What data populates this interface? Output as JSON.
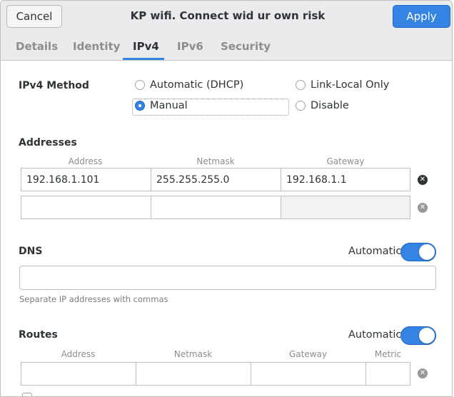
{
  "header": {
    "cancel_label": "Cancel",
    "title": "KP wifi. Connect wid ur own risk",
    "apply_label": "Apply",
    "accent_color": "#3584e4"
  },
  "tabs": [
    {
      "label": "Details"
    },
    {
      "label": "Identity"
    },
    {
      "label": "IPv4"
    },
    {
      "label": "IPv6"
    },
    {
      "label": "Security"
    }
  ],
  "active_tab": "IPv4",
  "method": {
    "label": "IPv4 Method",
    "options": [
      {
        "label": "Automatic (DHCP)",
        "selected": false
      },
      {
        "label": "Link-Local Only",
        "selected": false
      },
      {
        "label": "Manual",
        "selected": true
      },
      {
        "label": "Disable",
        "selected": false
      }
    ]
  },
  "addresses": {
    "label": "Addresses",
    "columns": [
      "Address",
      "Netmask",
      "Gateway"
    ],
    "rows": [
      [
        "192.168.1.101",
        "255.255.255.0",
        "192.168.1.1"
      ],
      [
        "",
        "",
        ""
      ]
    ]
  },
  "dns": {
    "label": "DNS",
    "automatic_label": "Automatic",
    "automatic": true,
    "value": "",
    "hint": "Separate IP addresses with commas"
  },
  "routes": {
    "label": "Routes",
    "automatic_label": "Automatic",
    "automatic": true,
    "columns": [
      "Address",
      "Netmask",
      "Gateway",
      "Metric"
    ],
    "rows": [
      [
        "",
        "",
        "",
        ""
      ]
    ]
  }
}
